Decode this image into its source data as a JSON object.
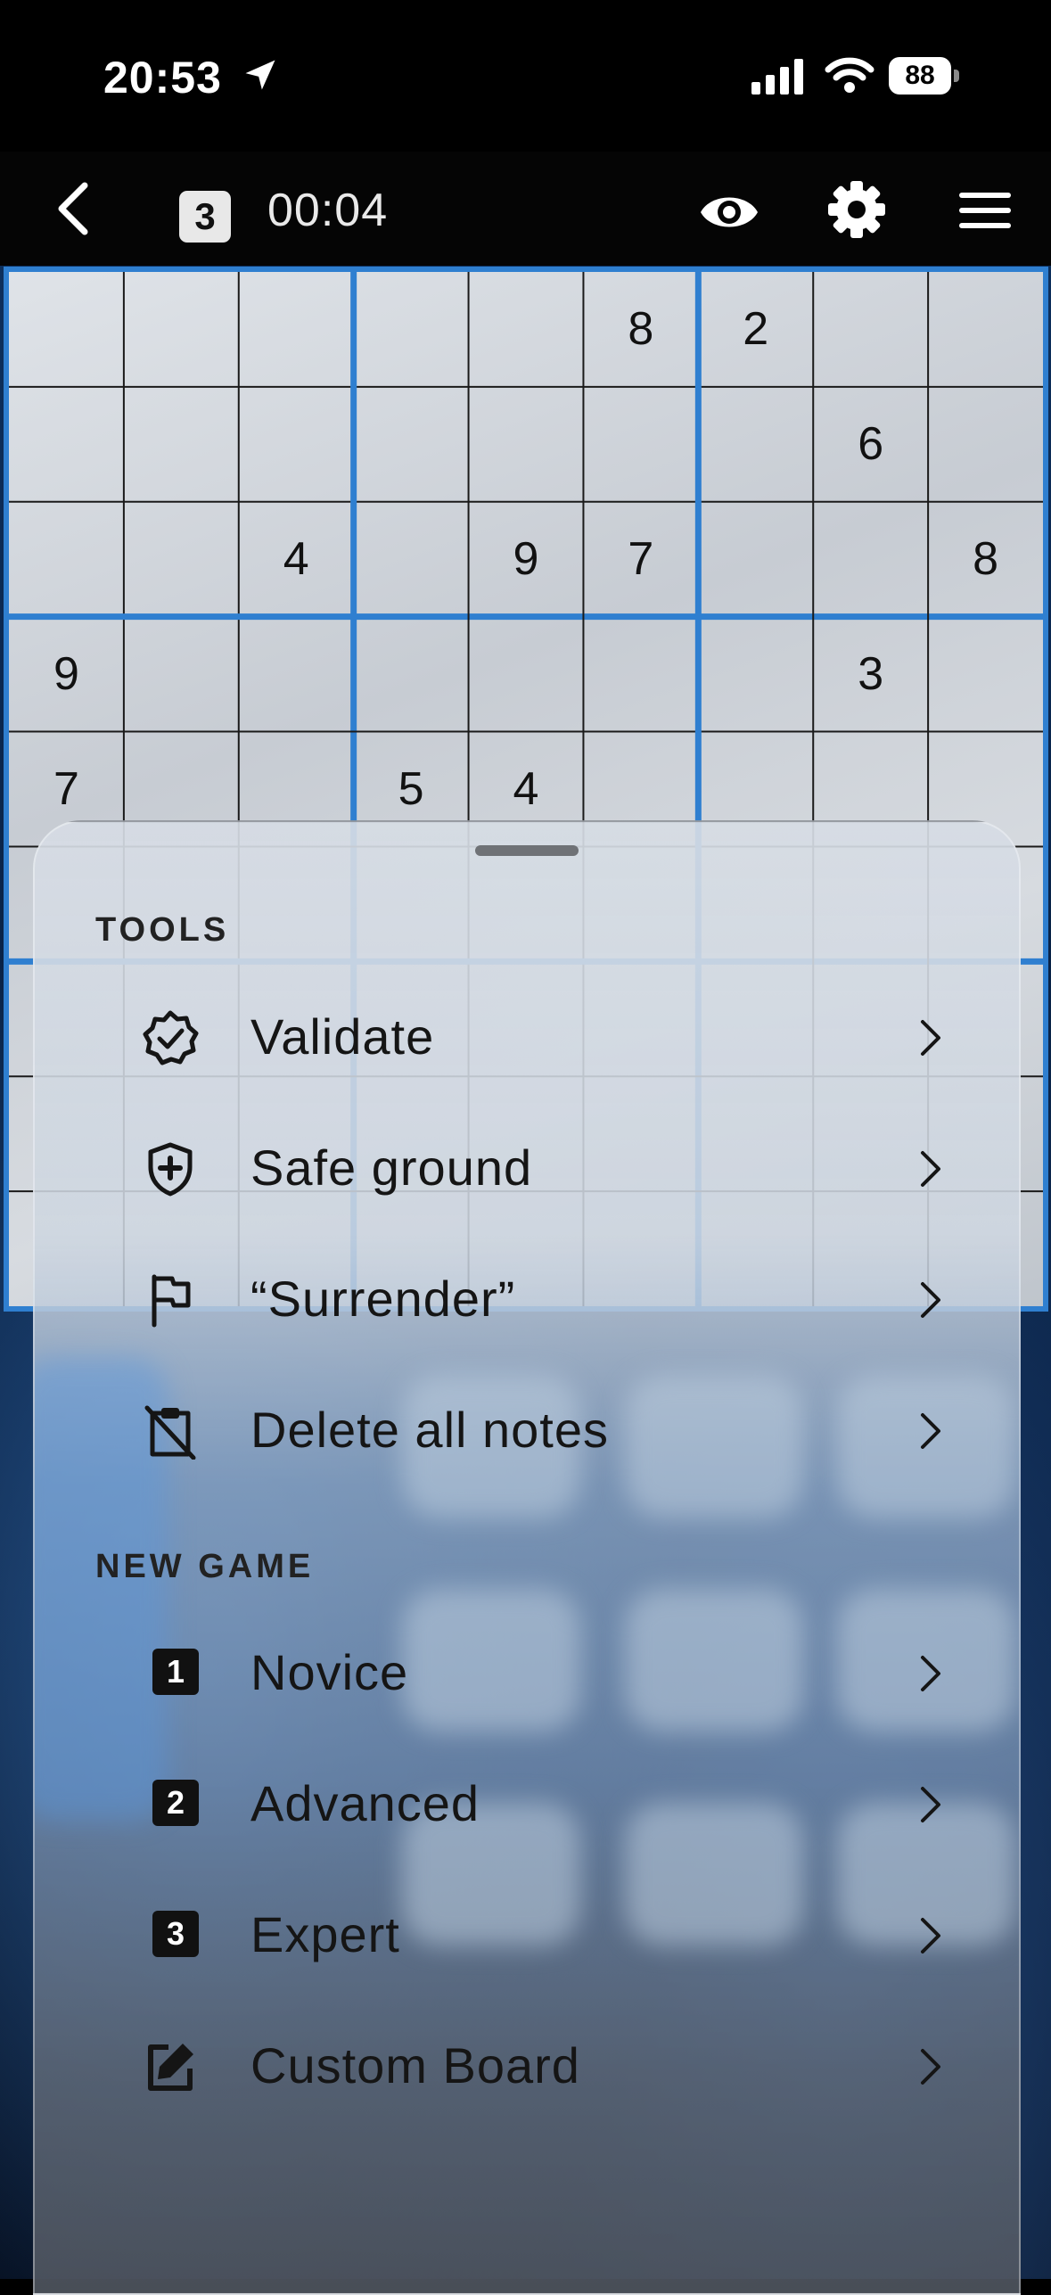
{
  "status_bar": {
    "time": "20:53",
    "battery": "88",
    "icons": [
      "location-arrow-icon",
      "signal-icon",
      "wifi-icon",
      "battery-icon"
    ]
  },
  "toolbar": {
    "level_badge": "3",
    "timer": "00:04",
    "icons": [
      "back-chevron-icon",
      "eye-icon",
      "gear-icon",
      "hamburger-menu-icon"
    ]
  },
  "board": {
    "rows": [
      [
        "",
        "",
        "",
        "",
        "",
        "8",
        "2",
        "",
        ""
      ],
      [
        "",
        "",
        "",
        "",
        "",
        "",
        "",
        "6",
        ""
      ],
      [
        "",
        "",
        "4",
        "",
        "9",
        "7",
        "",
        "",
        "8"
      ],
      [
        "9",
        "",
        "",
        "",
        "",
        "",
        "",
        "3",
        ""
      ],
      [
        "7",
        "",
        "",
        "5",
        "4",
        "",
        "",
        "",
        ""
      ]
    ],
    "colors": {
      "box_border": "#2f7fd0",
      "cell_line": "#1a1a1a"
    }
  },
  "sheet": {
    "tools_title": "TOOLS",
    "tools": [
      {
        "label": "Validate",
        "icon": "badge-check-icon"
      },
      {
        "label": "Safe ground",
        "icon": "shield-plus-icon"
      },
      {
        "label": "“Surrender”",
        "icon": "flag-icon"
      },
      {
        "label": "Delete all notes",
        "icon": "clipboard-off-icon"
      }
    ],
    "new_game_title": "NEW GAME",
    "new_game": [
      {
        "label": "Novice",
        "badge": "1"
      },
      {
        "label": "Advanced",
        "badge": "2"
      },
      {
        "label": "Expert",
        "badge": "3"
      },
      {
        "label": "Custom Board",
        "icon": "edit-square-icon"
      }
    ]
  }
}
